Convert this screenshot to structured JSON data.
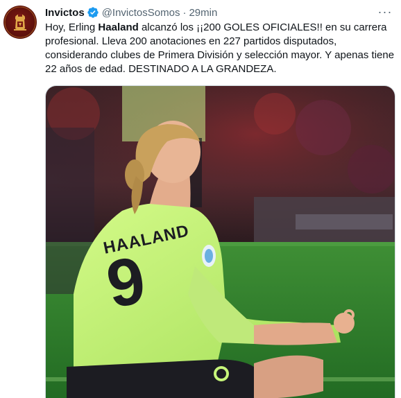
{
  "tweet": {
    "display_name": "Invictos",
    "handle": "@InvictosSomos",
    "separator": "·",
    "time": "29min",
    "more_label": "···",
    "text_before": "Hoy, Erling ",
    "text_bold": "Haaland",
    "text_after": " alcanzó los ¡¡200 GOLES OFICIALES!! en su carrera profesional. Lleva 200 anotaciones en 227 partidos disputados, considerando clubes de Primera División y selección mayor. Y apenas tiene 22 años de edad. DESTINADO A LA GRANDEZA."
  },
  "photo": {
    "shirt_name": "HAALAND",
    "shirt_number": "9",
    "colors": {
      "kit": "#c7f57a",
      "pitch": "#2f7d2a",
      "stands": "#2a1a1e"
    }
  },
  "colors": {
    "verified_blue": "#1d9bf0",
    "muted_text": "#536471"
  }
}
